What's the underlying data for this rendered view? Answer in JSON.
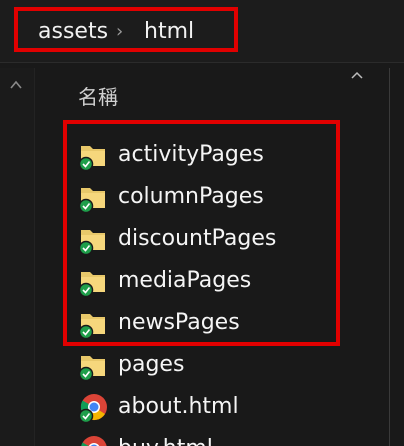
{
  "breadcrumb": {
    "items": [
      "assets",
      "html"
    ],
    "separator": "›"
  },
  "header": {
    "name_column": "名稱"
  },
  "files": [
    {
      "name": "activityPages",
      "icon": "folder-icon",
      "status": "synced-check-icon"
    },
    {
      "name": "columnPages",
      "icon": "folder-icon",
      "status": "synced-check-icon"
    },
    {
      "name": "discountPages",
      "icon": "folder-icon",
      "status": "synced-check-icon"
    },
    {
      "name": "mediaPages",
      "icon": "folder-icon",
      "status": "synced-check-icon"
    },
    {
      "name": "newsPages",
      "icon": "folder-icon",
      "status": "synced-check-icon"
    },
    {
      "name": "pages",
      "icon": "folder-icon",
      "status": "synced-check-icon"
    },
    {
      "name": "about.html",
      "icon": "chrome-icon",
      "status": "synced-check-icon"
    },
    {
      "name": "buy.html",
      "icon": "chrome-icon",
      "status": "synced-check-icon"
    }
  ],
  "colors": {
    "highlight": "#e10000",
    "background": "#191919",
    "folder": "#e8c86a",
    "sync_check": "#1e9e4a"
  }
}
